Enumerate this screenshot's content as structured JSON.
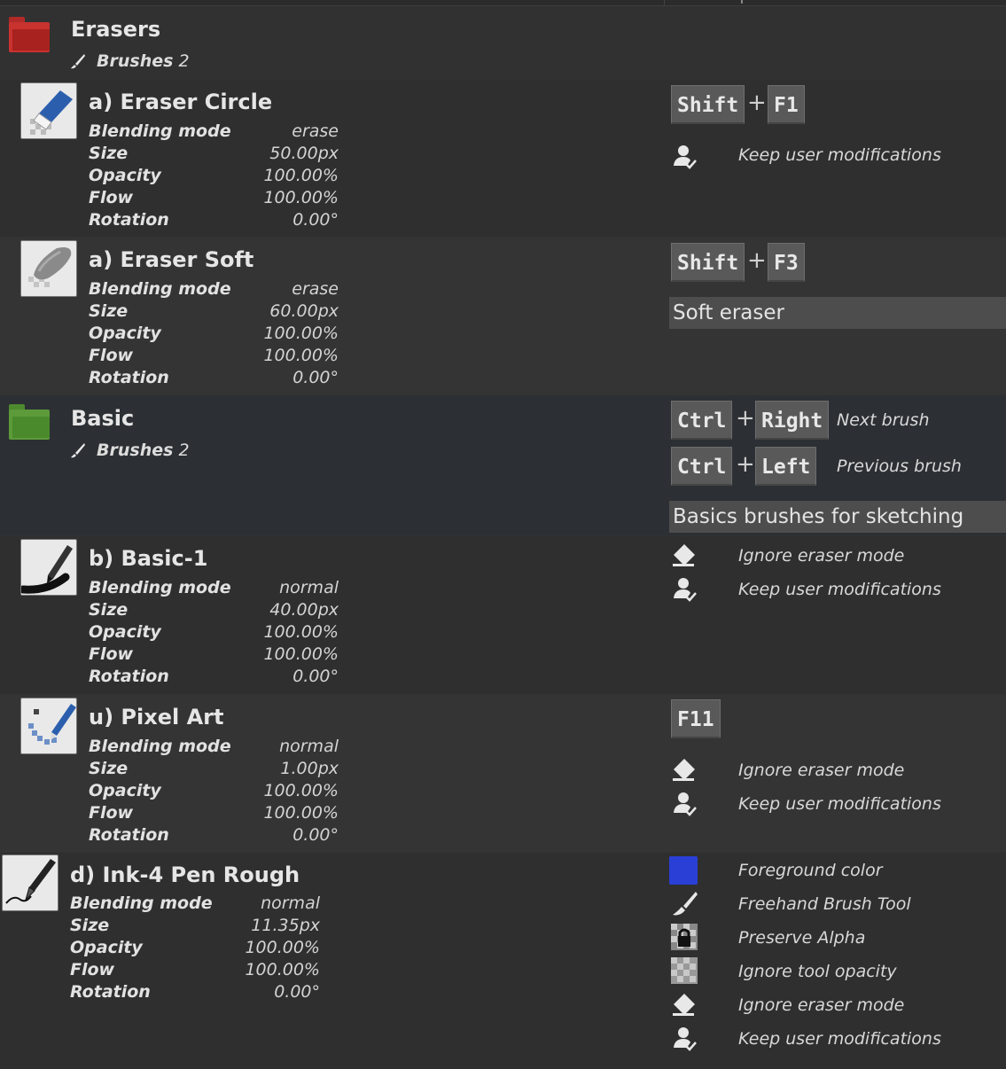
{
  "groups": [
    {
      "name": "Erasers",
      "brushes_label": "Brushes",
      "brushes_count": "2",
      "color": "#c8322f"
    },
    {
      "name": "Basic",
      "brushes_label": "Brushes",
      "brushes_count": "2",
      "color": "#5c9a3a",
      "shortcuts": [
        {
          "keys": [
            "Ctrl",
            "Right"
          ],
          "plus": "+",
          "desc": "Next brush"
        },
        {
          "keys": [
            "Ctrl",
            "Left"
          ],
          "plus": "+",
          "desc": "Previous brush"
        }
      ],
      "comment": "Basics brushes for sketching"
    }
  ],
  "prop_labels": {
    "blending": "Blending mode",
    "size": "Size",
    "opacity": "Opacity",
    "flow": "Flow",
    "rotation": "Rotation"
  },
  "brushes": [
    {
      "name": "a) Eraser Circle",
      "blending": "erase",
      "size": "50.00px",
      "opacity": "100.00%",
      "flow": "100.00%",
      "rotation": "0.00°",
      "shortcut": [
        "Shift",
        "F1"
      ],
      "plus": "+",
      "flags": [
        "Keep user modifications"
      ]
    },
    {
      "name": "a) Eraser Soft",
      "blending": "erase",
      "size": "60.00px",
      "opacity": "100.00%",
      "flow": "100.00%",
      "rotation": "0.00°",
      "shortcut": [
        "Shift",
        "F3"
      ],
      "plus": "+",
      "comment": "Soft eraser"
    },
    {
      "name": "b) Basic-1",
      "blending": "normal",
      "size": "40.00px",
      "opacity": "100.00%",
      "flow": "100.00%",
      "rotation": "0.00°",
      "flags": [
        "Ignore eraser mode",
        "Keep user modifications"
      ]
    },
    {
      "name": "u) Pixel Art",
      "blending": "normal",
      "size": "1.00px",
      "opacity": "100.00%",
      "flow": "100.00%",
      "rotation": "0.00°",
      "shortcut": [
        "F11"
      ],
      "flags": [
        "Ignore eraser mode",
        "Keep user modifications"
      ]
    },
    {
      "name": "d) Ink-4 Pen Rough",
      "blending": "normal",
      "size": "11.35px",
      "opacity": "100.00%",
      "flow": "100.00%",
      "rotation": "0.00°",
      "flags": [
        "Foreground color",
        "Freehand Brush Tool",
        "Preserve Alpha",
        "Ignore tool opacity",
        "Ignore eraser mode",
        "Keep user modifications"
      ],
      "foreground_color": "#2a3fd6"
    }
  ]
}
